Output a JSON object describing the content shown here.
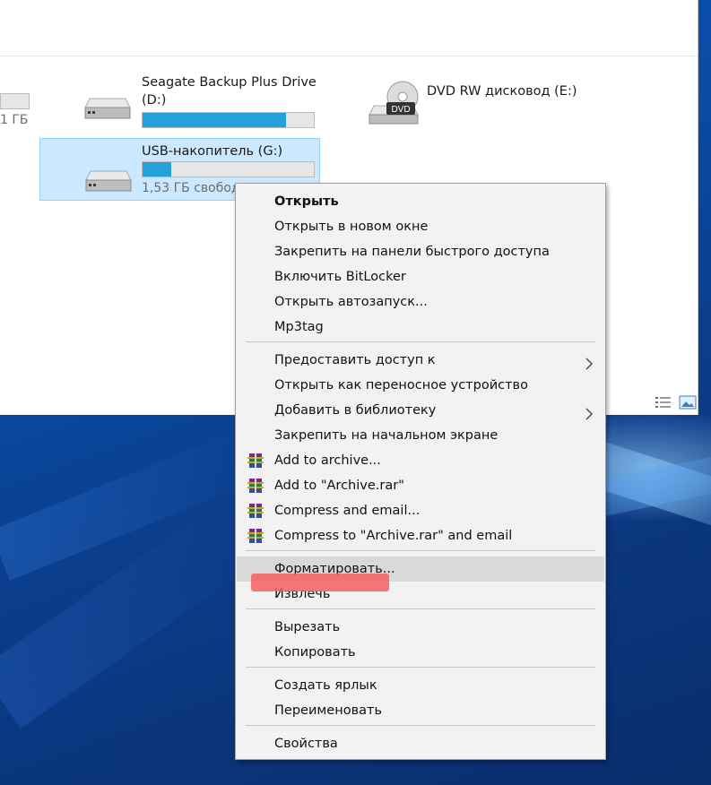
{
  "drives": {
    "left_partial": {
      "free_text": "1 ГБ",
      "fill": 0.0
    },
    "seagate": {
      "name_line1": "Seagate Backup Plus Drive",
      "name_line2": "(D:)",
      "fill": 0.84
    },
    "dvd": {
      "name": "DVD RW дисковод (E:)",
      "badge": "DVD"
    },
    "usb": {
      "name": "USB-накопитель (G:)",
      "free_text": "1,53 ГБ свободо",
      "fill": 0.17
    }
  },
  "context_menu": {
    "items": [
      {
        "label": "Открыть",
        "bold": true
      },
      {
        "label": "Открыть в новом окне"
      },
      {
        "label": "Закрепить на панели быстрого доступа"
      },
      {
        "label": "Включить BitLocker"
      },
      {
        "label": "Открыть автозапуск..."
      },
      {
        "label": "Mp3tag"
      },
      {
        "label": "Предоставить доступ к",
        "submenu": true
      },
      {
        "label": "Открыть как переносное устройство"
      },
      {
        "label": "Добавить в библиотеку",
        "submenu": true
      },
      {
        "label": "Закрепить на начальном экране"
      },
      {
        "label": "Add to archive...",
        "icon": "winrar-icon"
      },
      {
        "label": "Add to \"Archive.rar\"",
        "icon": "winrar-icon"
      },
      {
        "label": "Compress and email...",
        "icon": "winrar-icon"
      },
      {
        "label": "Compress to \"Archive.rar\" and email",
        "icon": "winrar-icon"
      },
      {
        "label": "Форматировать...",
        "highlighted": true
      },
      {
        "label": "Извлечь"
      },
      {
        "label": "Вырезать"
      },
      {
        "label": "Копировать"
      },
      {
        "label": "Создать ярлык"
      },
      {
        "label": "Переименовать"
      },
      {
        "label": "Свойства"
      }
    ]
  },
  "colors": {
    "selection_bg": "#cce8ff",
    "progress_fill": "#26a0da",
    "menu_bg": "#f2f2f2",
    "menu_highlight": "#d9d9d9",
    "annotation_mark": "#f55a5a",
    "desktop_blue": "#0a4aa3"
  },
  "icons": {
    "drive": "hard-drive-icon",
    "dvd": "dvd-drive-icon",
    "submenu": "chevron-right-icon",
    "winrar": "winrar-icon",
    "view_details": "details-view-icon",
    "view_tiles": "large-icons-view-icon"
  }
}
